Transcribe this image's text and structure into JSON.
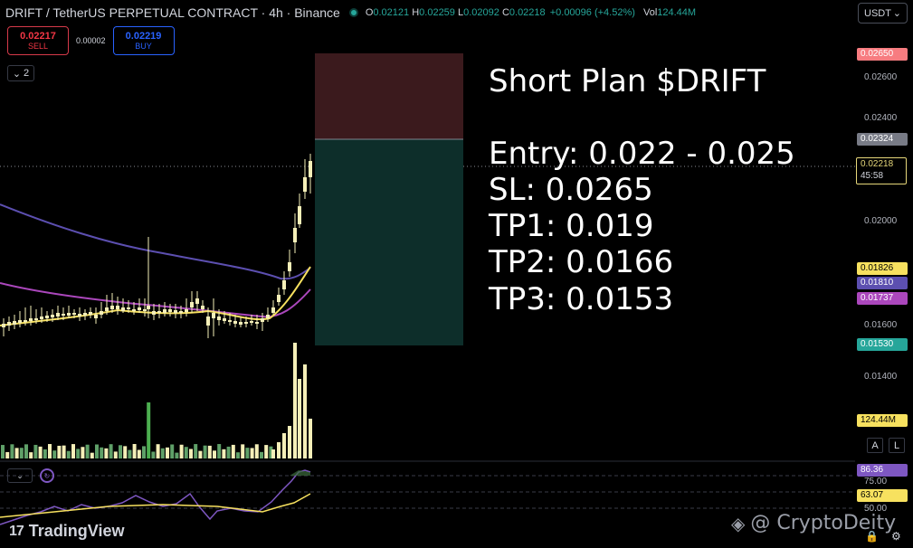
{
  "header": {
    "title": "DRIFT / TetherUS PERPETUAL CONTRACT · 4h · Binance",
    "open_label": "O",
    "open": "0.02121",
    "high_label": "H",
    "high": "0.02259",
    "low_label": "L",
    "low": "0.02092",
    "close_label": "C",
    "close": "0.02218",
    "change": "+0.00096 (+4.52%)",
    "vol_label": "Vol",
    "vol": "124.44M"
  },
  "trade": {
    "sell_price": "0.02217",
    "sell_label": "SELL",
    "spread": "0.00002",
    "buy_price": "0.02219",
    "buy_label": "BUY"
  },
  "indicators_toggle": "2",
  "currency": "USDT",
  "overlay": {
    "title": "Short Plan $DRIFT",
    "entry": "Entry: 0.022 - 0.025",
    "sl": "SL: 0.0265",
    "tp1": "TP1: 0.019",
    "tp2": "TP2: 0.0166",
    "tp3": "TP3: 0.0153"
  },
  "price_axis": {
    "ticks": [
      "0.02600",
      "0.02400",
      "0.02000",
      "0.01600",
      "0.01400"
    ],
    "sl_tag": "0.02650",
    "target_tag": "0.02324",
    "current_price": "0.02218",
    "countdown": "45:58",
    "ma1_tag": "0.01826",
    "ma2_tag": "0.01810",
    "ma3_tag": "0.01737",
    "tp_tag": "0.01530",
    "volume_tag": "124.44M"
  },
  "scale_buttons": {
    "auto": "A",
    "log": "L"
  },
  "rsi": {
    "value": "86.36",
    "level_high": "75.00",
    "ma_value": "63.07",
    "level_mid": "50.00"
  },
  "brand": {
    "name": "TradingView",
    "mark": "17"
  },
  "watermark": {
    "text": "@ CryptoDeity"
  },
  "colors": {
    "up": "#26a69a",
    "down": "#f23645",
    "candle": "#f5efb8",
    "ma_yellow": "#f7e15f",
    "ma_purple": "#ab47bc",
    "ma_indigo": "#5c4fb0",
    "stop_zone": "#3b1a1d",
    "target_zone": "#0d2e2a"
  }
}
